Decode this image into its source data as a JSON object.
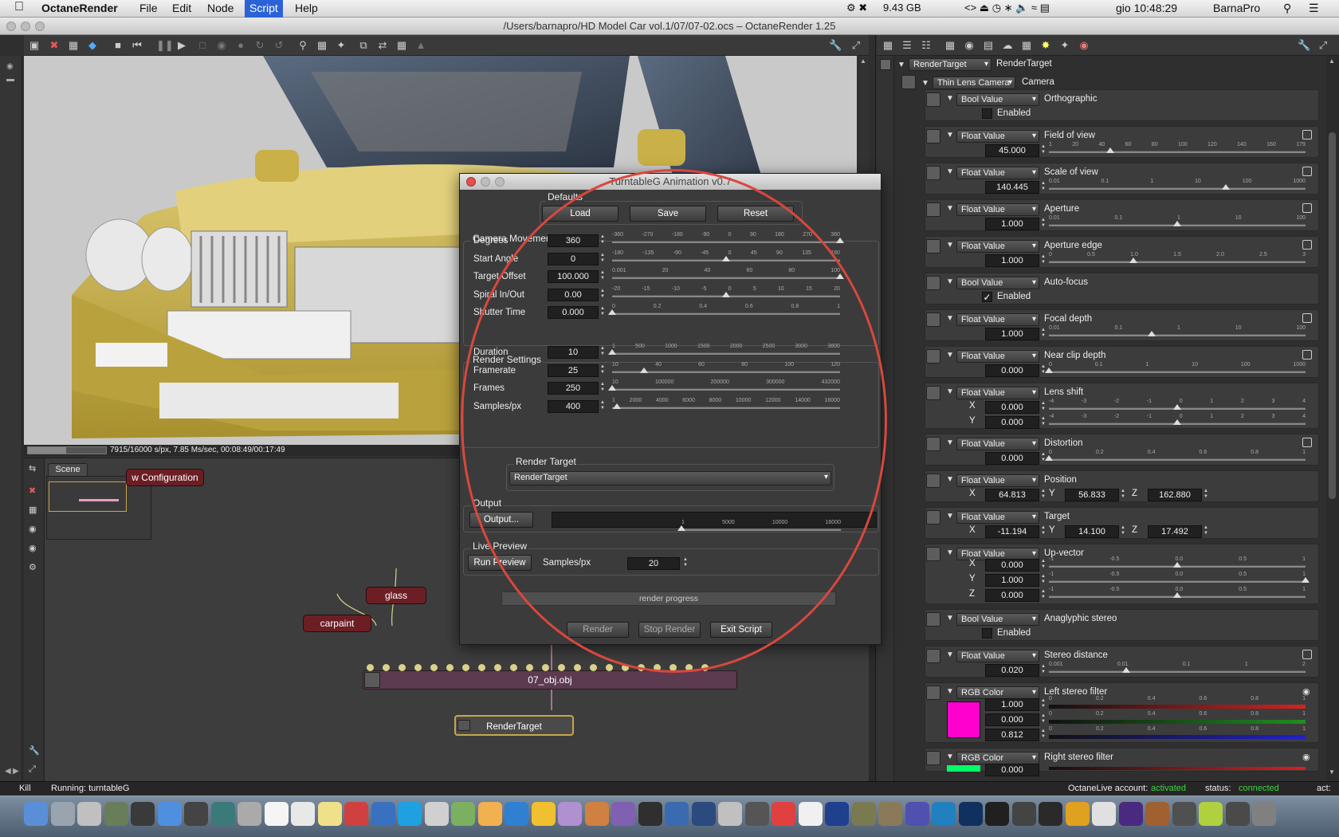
{
  "menubar": {
    "app_name": "OctaneRender",
    "menus": [
      "File",
      "Edit",
      "Node",
      "Script",
      "Help"
    ],
    "memory": "9.43 GB",
    "clock": "gio 10:48:29",
    "user": "BarnaPro"
  },
  "window": {
    "title": "/Users/barnapro/HD Model Car vol.1/07/07-02.ocs – OctaneRender 1.25"
  },
  "viewport": {
    "status": "7915/16000 s/px, 7.85 Ms/sec, 00:08:49/00:17:49",
    "progress": 0.49
  },
  "scene": {
    "tab": "Scene",
    "preview_label": "w Configuration",
    "nodes": {
      "glass": "glass",
      "carpaint": "carpaint",
      "obj": "07_obj.obj",
      "render_target": "RenderTarget"
    }
  },
  "dialog": {
    "title": "TurntableG Animation v0.7",
    "defaults": {
      "title": "Defaults",
      "load": "Load",
      "save": "Save",
      "reset": "Reset"
    },
    "camera_movement": {
      "title": "Camera Movement",
      "rows": [
        {
          "label": "Degrees",
          "value": "360",
          "ticks": [
            "-360",
            "-270",
            "-180",
            "-90",
            "0",
            "90",
            "180",
            "270",
            "360"
          ],
          "pos": 1.0
        },
        {
          "label": "Start Angle",
          "value": "0",
          "ticks": [
            "-180",
            "-135",
            "-90",
            "-45",
            "0",
            "45",
            "90",
            "135",
            "180"
          ],
          "pos": 0.5
        },
        {
          "label": "Target Offset",
          "value": "100.000",
          "ticks": [
            "0.001",
            "20",
            "40",
            "60",
            "80",
            "100"
          ],
          "pos": 1.0
        },
        {
          "label": "Spiral In/Out",
          "value": "0.00",
          "ticks": [
            "-20",
            "-15",
            "-10",
            "-5",
            "0",
            "5",
            "10",
            "15",
            "20"
          ],
          "pos": 0.5
        },
        {
          "label": "Shutter Time",
          "value": "0.000",
          "ticks": [
            "0",
            "0.2",
            "0.4",
            "0.6",
            "0.8",
            "1"
          ],
          "pos": 0.0
        }
      ]
    },
    "render_settings": {
      "title": "Render Settings",
      "rows": [
        {
          "label": "Duration",
          "value": "10",
          "ticks": [
            "1",
            "500",
            "1000",
            "1500",
            "2000",
            "2500",
            "3000",
            "3600"
          ],
          "pos": 0.0
        },
        {
          "label": "Framerate",
          "value": "25",
          "ticks": [
            "10",
            "40",
            "60",
            "80",
            "100",
            "120"
          ],
          "pos": 0.14
        },
        {
          "label": "Frames",
          "value": "250",
          "ticks": [
            "10",
            "100000",
            "200000",
            "300000",
            "432000"
          ],
          "pos": 0.0
        },
        {
          "label": "Samples/px",
          "value": "400",
          "ticks": [
            "1",
            "2000",
            "4000",
            "6000",
            "8000",
            "10000",
            "12000",
            "14000",
            "16000"
          ],
          "pos": 0.02
        }
      ]
    },
    "render_target": {
      "title": "Render Target",
      "selected": "RenderTarget"
    },
    "output": {
      "title": "Output",
      "button": "Output...",
      "path": ""
    },
    "live_preview": {
      "title": "Live Preview",
      "button": "Run Preview",
      "samples_label": "Samples/px",
      "samples_value": "20",
      "ticks": [
        "1",
        "5000",
        "10000",
        "16000"
      ],
      "pos": 0.0
    },
    "progress_text": "render progress",
    "footer": {
      "render": "Render",
      "stop": "Stop Render",
      "exit": "Exit Script"
    }
  },
  "node_inspector": {
    "root": {
      "type": "RenderTarget",
      "name": "RenderTarget"
    },
    "camera": {
      "type": "Thin Lens Camera",
      "name": "Camera"
    },
    "params": [
      {
        "kind": "bool",
        "type": "Bool Value",
        "name": "Orthographic",
        "checked": false,
        "check_label": "Enabled"
      },
      {
        "kind": "float",
        "type": "Float Value",
        "name": "Field of view",
        "value": "45.000",
        "ticks": [
          "1",
          "20",
          "40",
          "60",
          "80",
          "100",
          "120",
          "140",
          "160",
          "179"
        ],
        "pos": 0.24
      },
      {
        "kind": "float",
        "type": "Float Value",
        "name": "Scale of view",
        "value": "140.445",
        "ticks": [
          "0.01",
          "0.1",
          "1",
          "10",
          "100",
          "1000"
        ],
        "pos": 0.69
      },
      {
        "kind": "float",
        "type": "Float Value",
        "name": "Aperture",
        "value": "1.000",
        "ticks": [
          "0.01",
          "0.1",
          "1",
          "10",
          "100"
        ],
        "pos": 0.5
      },
      {
        "kind": "float",
        "type": "Float Value",
        "name": "Aperture edge",
        "value": "1.000",
        "ticks": [
          "0",
          "0.5",
          "1.0",
          "1.5",
          "2.0",
          "2.5",
          "3"
        ],
        "pos": 0.33
      },
      {
        "kind": "bool",
        "type": "Bool Value",
        "name": "Auto-focus",
        "checked": true,
        "check_label": "Enabled"
      },
      {
        "kind": "float",
        "type": "Float Value",
        "name": "Focal depth",
        "value": "1.000",
        "ticks": [
          "0.01",
          "0.1",
          "1",
          "10",
          "100"
        ],
        "pos": 0.4
      },
      {
        "kind": "float",
        "type": "Float Value",
        "name": "Near clip depth",
        "value": "0.000",
        "ticks": [
          "0",
          "0.1",
          "1",
          "10",
          "100",
          "1000"
        ],
        "pos": 0.0
      },
      {
        "kind": "xy",
        "type": "Float Value",
        "name": "Lens shift",
        "x": "0.000",
        "y": "0.000",
        "ticks": [
          "-4",
          "-3",
          "-2",
          "-1",
          "0",
          "1",
          "2",
          "3",
          "4"
        ],
        "pos": 0.5
      },
      {
        "kind": "float",
        "type": "Float Value",
        "name": "Distortion",
        "value": "0.000",
        "ticks": [
          "0",
          "0.2",
          "0.4",
          "0.6",
          "0.8",
          "1"
        ],
        "pos": 0.0
      },
      {
        "kind": "xyz",
        "type": "Float Value",
        "name": "Position",
        "x": "64.813",
        "y": "56.833",
        "z": "162.880"
      },
      {
        "kind": "xyz",
        "type": "Float Value",
        "name": "Target",
        "x": "-11.194",
        "y": "14.100",
        "z": "17.492"
      },
      {
        "kind": "xyz3",
        "type": "Float Value",
        "name": "Up-vector",
        "x": "0.000",
        "y": "1.000",
        "z": "0.000",
        "ticks": [
          "-1",
          "-0.5",
          "0.0",
          "0.5",
          "1"
        ],
        "pos": [
          0.5,
          1.0,
          0.5
        ]
      },
      {
        "kind": "bool",
        "type": "Bool Value",
        "name": "Anaglyphic stereo",
        "checked": false,
        "check_label": "Enabled"
      },
      {
        "kind": "float",
        "type": "Float Value",
        "name": "Stereo distance",
        "value": "0.020",
        "ticks": [
          "0.001",
          "0.01",
          "0.1",
          "1",
          "2"
        ],
        "pos": 0.3
      },
      {
        "kind": "rgb",
        "type": "RGB Color",
        "name": "Left stereo filter",
        "r": "1.000",
        "g": "0.000",
        "b": "0.812",
        "swatch": "#ff00cf",
        "ticks": [
          "0",
          "0.2",
          "0.4",
          "0.6",
          "0.8",
          "1"
        ]
      },
      {
        "kind": "rgb_partial",
        "type": "RGB Color",
        "name": "Right stereo filter",
        "r": "0.000",
        "swatch": "#00ff66"
      }
    ]
  },
  "statusbar": {
    "kill": "Kill",
    "running": "Running: turntableG",
    "account_label": "OctaneLive account:",
    "account_value": "activated",
    "status_label": "status:",
    "status_value": "connected",
    "act": "act:"
  },
  "colors": {
    "accent_red": "#d9473e",
    "node_red": "#6b1f24",
    "ok_green": "#3ed63e"
  }
}
